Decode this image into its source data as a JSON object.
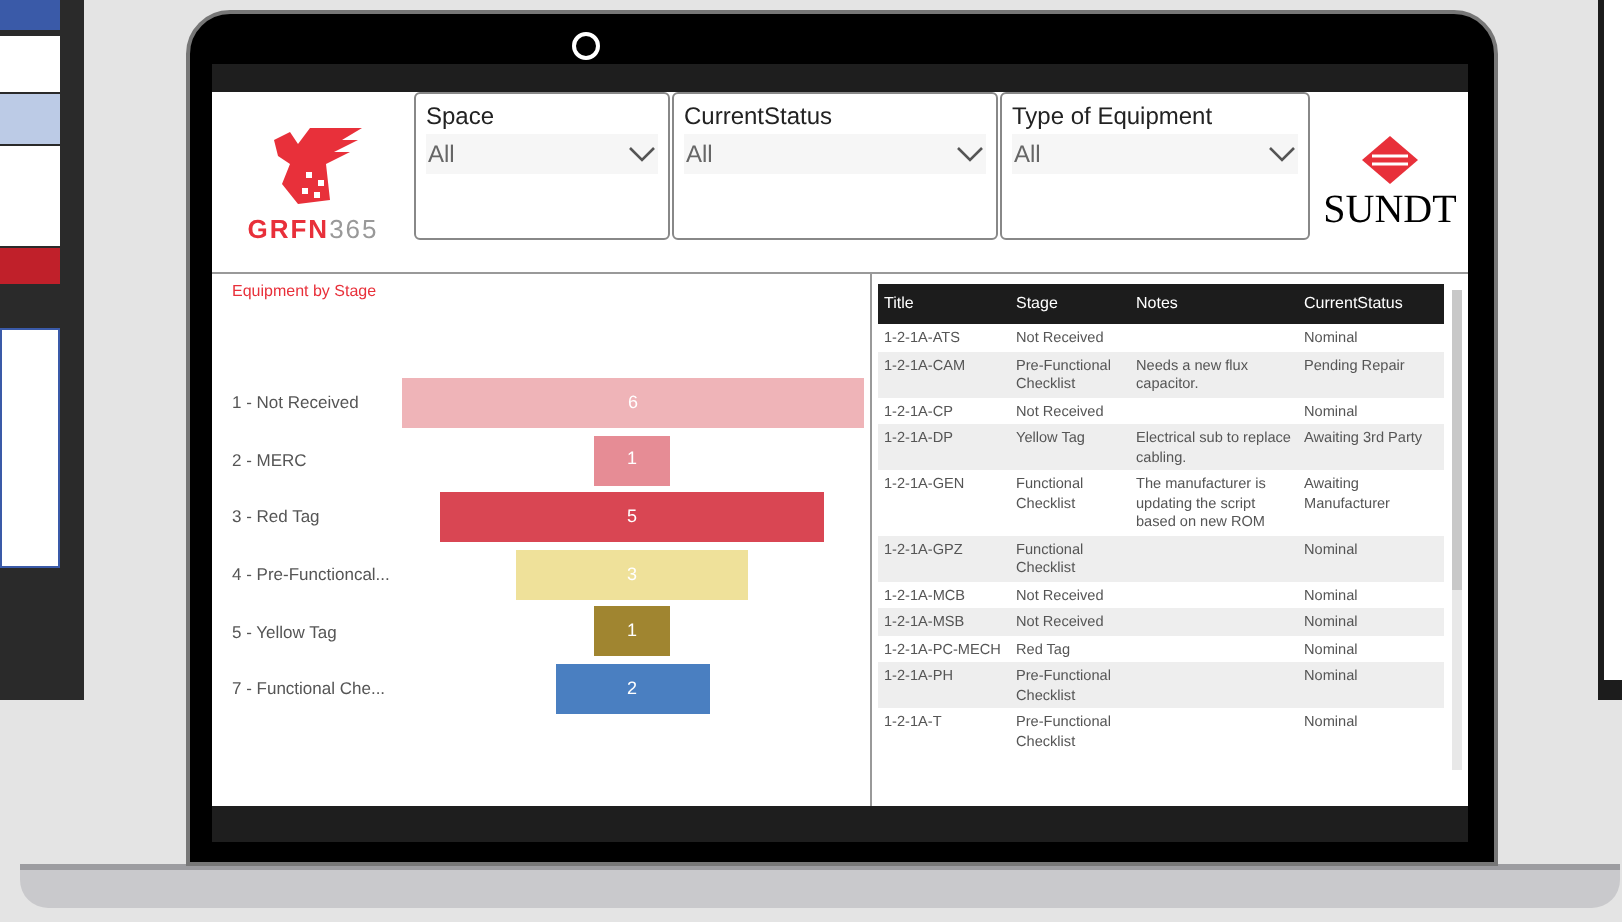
{
  "logo_left": {
    "text": "GRFN",
    "suffix": "365"
  },
  "slicers": [
    {
      "label": "Space",
      "value": "All"
    },
    {
      "label": "CurrentStatus",
      "value": "All"
    },
    {
      "label": "Type of Equipment",
      "value": "All"
    }
  ],
  "logo_right": {
    "text": "SUNDT"
  },
  "funnel": {
    "title": "Equipment by Stage",
    "stages": [
      {
        "label": "1 - Not Received",
        "value": "6",
        "color": "#efb4b8"
      },
      {
        "label": "2 - MERC",
        "value": "1",
        "color": "#e68c95"
      },
      {
        "label": "3 - Red Tag",
        "value": "5",
        "color": "#d94653"
      },
      {
        "label": "4 - Pre-Functioncal...",
        "value": "3",
        "color": "#efe19a"
      },
      {
        "label": "5 - Yellow Tag",
        "value": "1",
        "color": "#a08530"
      },
      {
        "label": "7 - Functional Che...",
        "value": "2",
        "color": "#4a7fc1"
      }
    ]
  },
  "table": {
    "columns": [
      "Title",
      "Stage",
      "Notes",
      "CurrentStatus"
    ],
    "rows": [
      {
        "cells": [
          "1-2-1A-ATS",
          "Not Received",
          "",
          "Nominal"
        ]
      },
      {
        "cells": [
          "1-2-1A-CAM",
          "Pre-Functional Checklist",
          "Needs a new flux capacitor.",
          "Pending Repair"
        ]
      },
      {
        "cells": [
          "1-2-1A-CP",
          "Not Received",
          "",
          "Nominal"
        ]
      },
      {
        "cells": [
          "1-2-1A-DP",
          "Yellow Tag",
          "Electrical sub to replace cabling.",
          "Awaiting 3rd Party"
        ]
      },
      {
        "cells": [
          "1-2-1A-GEN",
          "Functional Checklist",
          "The manufacturer is updating the script based on new ROM",
          "Awaiting Manufacturer"
        ]
      },
      {
        "cells": [
          "1-2-1A-GPZ",
          "Functional Checklist",
          "",
          "Nominal"
        ]
      },
      {
        "cells": [
          "1-2-1A-MCB",
          "Not Received",
          "",
          "Nominal"
        ]
      },
      {
        "cells": [
          "1-2-1A-MSB",
          "Not Received",
          "",
          "Nominal"
        ]
      },
      {
        "cells": [
          "1-2-1A-PC-MECH",
          "Red Tag",
          "",
          "Nominal"
        ]
      },
      {
        "cells": [
          "1-2-1A-PH",
          "Pre-Functional Checklist",
          "",
          "Nominal"
        ]
      },
      {
        "cells": [
          "1-2-1A-T",
          "Pre-Functional Checklist",
          "",
          "Nominal"
        ]
      }
    ]
  }
}
